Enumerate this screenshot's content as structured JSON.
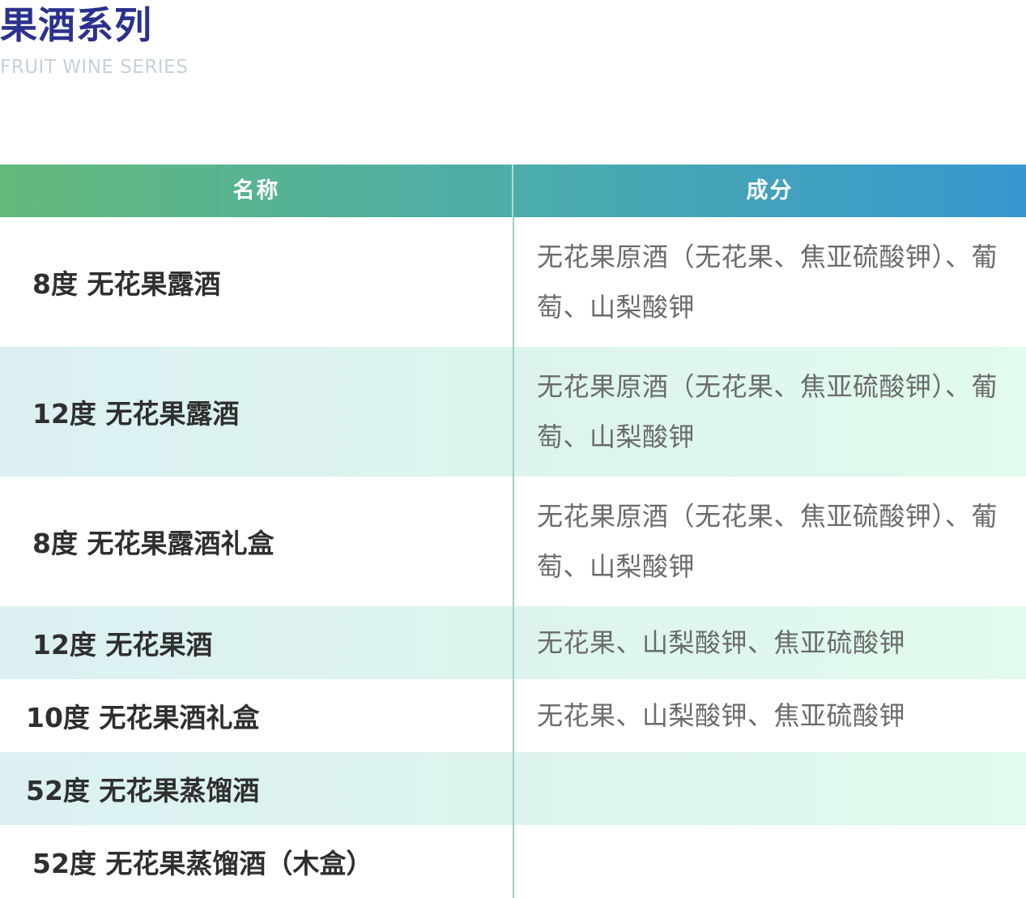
{
  "page": {
    "title": "果酒系列",
    "subtitle": "FRUIT WINE SERIES"
  },
  "table": {
    "headers": {
      "name": "名称",
      "composition": "成分"
    },
    "rows": [
      {
        "name": "8度  无花果露酒",
        "composition": "无花果原酒（无花果、焦亚硫酸钾）、葡萄、山梨酸钾"
      },
      {
        "name": "12度 无花果露酒",
        "composition": "无花果原酒（无花果、焦亚硫酸钾）、葡萄、山梨酸钾"
      },
      {
        "name": "8度  无花果露酒礼盒",
        "composition": "无花果原酒（无花果、焦亚硫酸钾）、葡萄、山梨酸钾"
      },
      {
        "name": "12度 无花果酒",
        "composition": "无花果、山梨酸钾、焦亚硫酸钾"
      },
      {
        "name": "10度 无花果酒礼盒",
        "composition": "无花果、山梨酸钾、焦亚硫酸钾"
      },
      {
        "name": "52度 无花果蒸馏酒",
        "composition": ""
      },
      {
        "name": "52度 无花果蒸馏酒（木盒）",
        "composition": ""
      }
    ]
  },
  "colors": {
    "title": "#2b318d",
    "subtitle": "#c6d1d9",
    "header_gradient_start": "#63b97a",
    "header_gradient_end": "#3897cf",
    "row_shade": "#dcf0f2"
  }
}
